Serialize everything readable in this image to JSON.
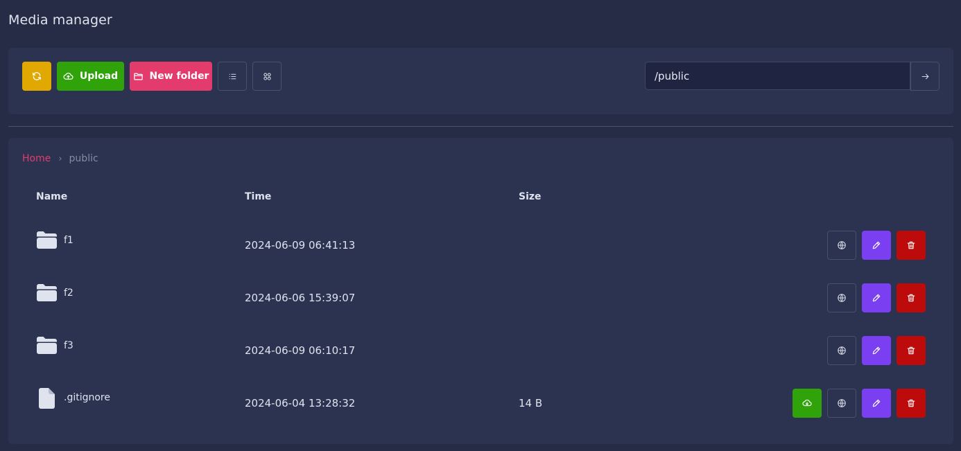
{
  "page": {
    "title": "Media manager"
  },
  "toolbar": {
    "refresh_icon": "refresh-icon",
    "upload_label": "Upload",
    "new_folder_label": "New folder",
    "path_value": "/public",
    "colors": {
      "refresh": "#e0a800",
      "upload": "#30a30b",
      "new_folder": "#e33c6c"
    }
  },
  "breadcrumb": {
    "home": "Home",
    "separator": "›",
    "current": "public"
  },
  "table": {
    "headers": {
      "name": "Name",
      "time": "Time",
      "size": "Size"
    },
    "rows": [
      {
        "type": "folder",
        "name": "f1",
        "time": "2024-06-09 06:41:13",
        "size": ""
      },
      {
        "type": "folder",
        "name": "f2",
        "time": "2024-06-06 15:39:07",
        "size": ""
      },
      {
        "type": "folder",
        "name": "f3",
        "time": "2024-06-09 06:10:17",
        "size": ""
      },
      {
        "type": "file",
        "name": ".gitignore",
        "time": "2024-06-04 13:28:32",
        "size": "14 B"
      }
    ]
  },
  "actions": {
    "colors": {
      "edit": "#7a3ff0",
      "delete": "#bd0a0a",
      "download": "#30a30b"
    }
  }
}
